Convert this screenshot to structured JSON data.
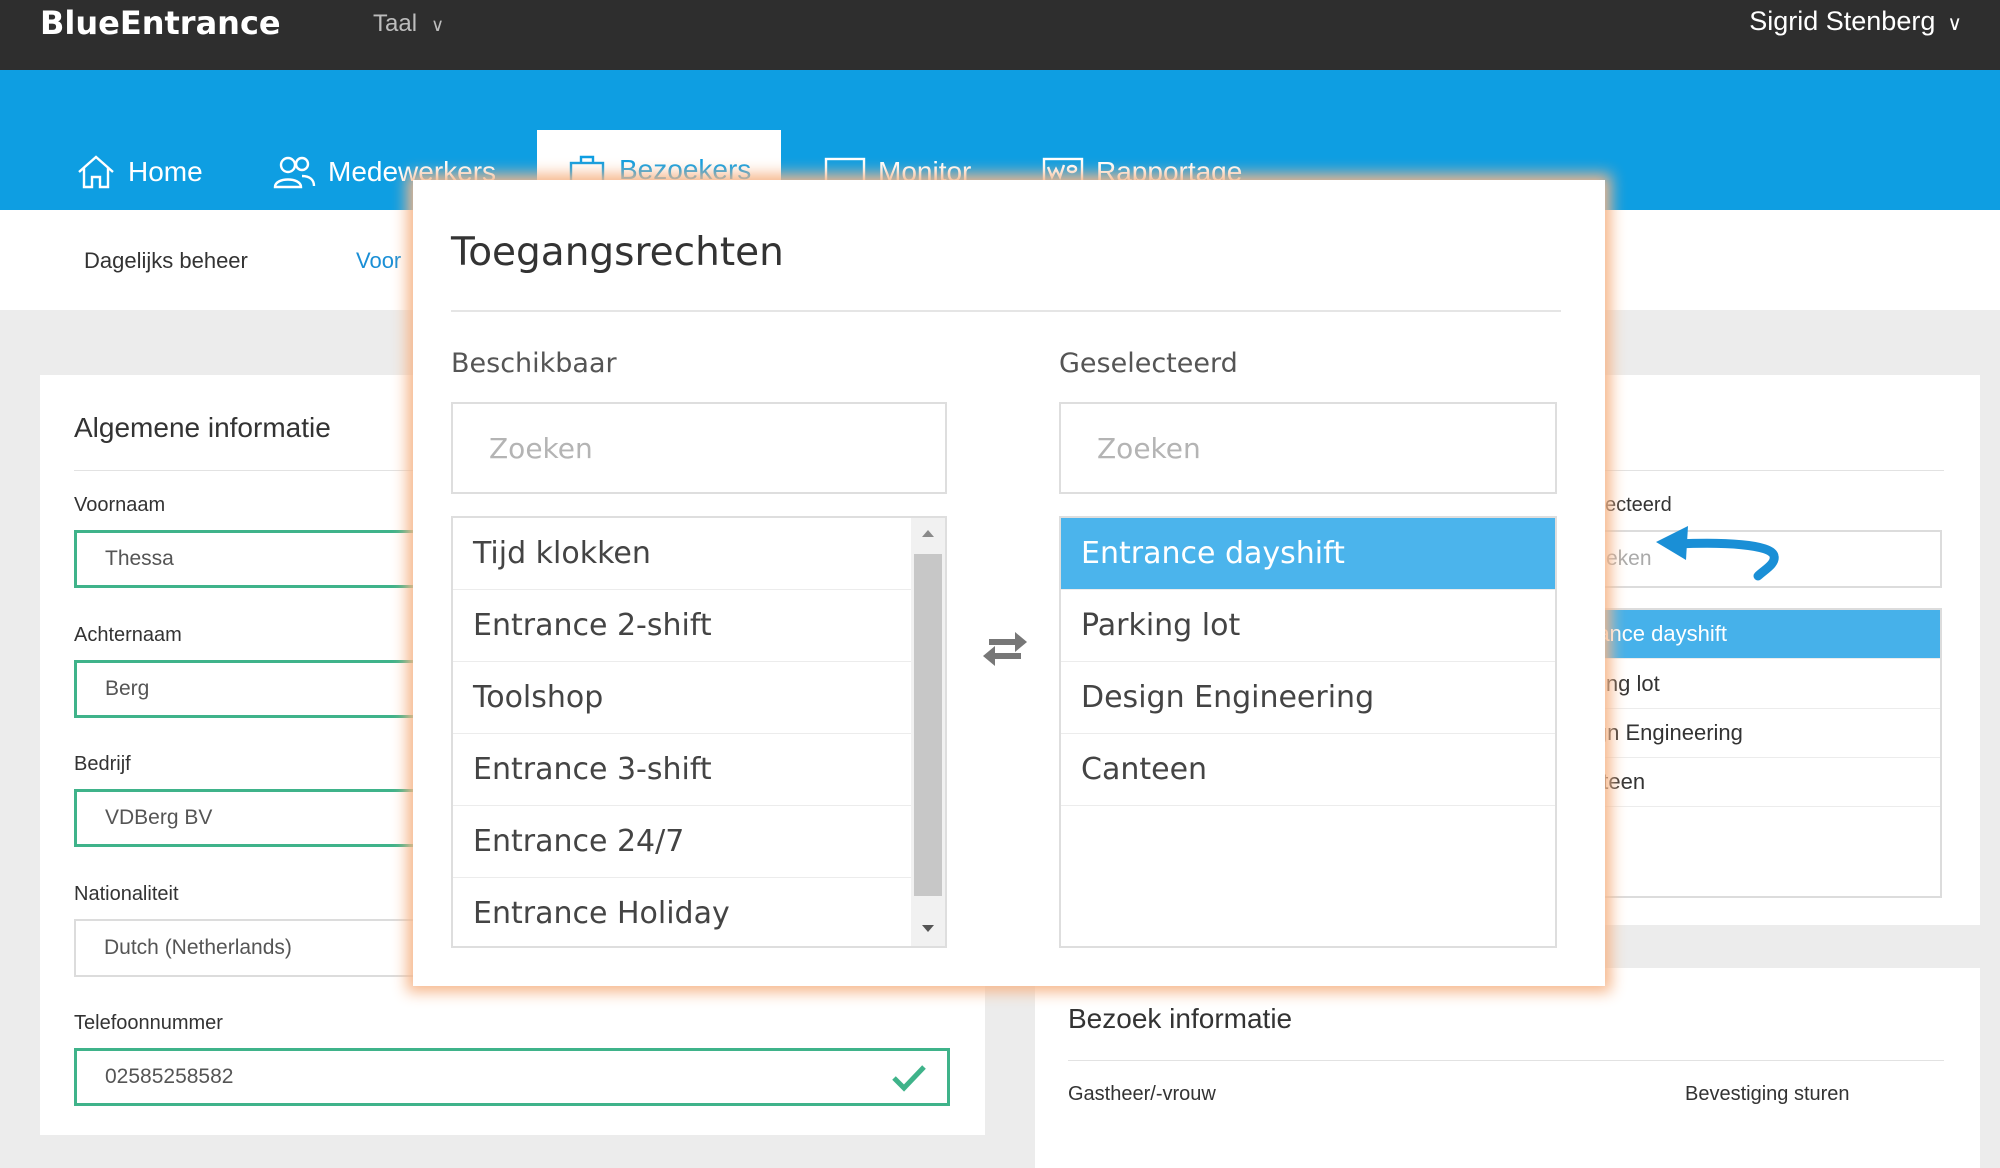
{
  "app": {
    "brand": "BlueEntrance",
    "language_label": "Taal",
    "user_name": "Sigrid Stenberg"
  },
  "nav": {
    "home": "Home",
    "employees": "Medewerkers",
    "visitors": "Bezoekers",
    "monitor": "Monitor",
    "reports": "Rapportage"
  },
  "subnav": {
    "daily": "Dagelijks beheer",
    "second": "Voor"
  },
  "left_card": {
    "title": "Algemene informatie",
    "first_name_label": "Voornaam",
    "first_name": "Thessa",
    "last_name_label": "Achternaam",
    "last_name": "Berg",
    "company_label": "Bedrijf",
    "company": "VDBerg BV",
    "nationality_label": "Nationaliteit",
    "nationality": "Dutch (Netherlands)",
    "phone_label": "Telefoonnummer",
    "phone": "02585258582"
  },
  "right_card_behind": {
    "selected_label": "ecteerd",
    "search_placeholder": "eken",
    "items": [
      "rance dayshift",
      "king lot",
      "ign Engineering",
      "nteen"
    ]
  },
  "visit_card": {
    "title": "Bezoek informatie",
    "host_label": "Gastheer/-vrouw",
    "confirm_label": "Bevestiging sturen"
  },
  "modal": {
    "title": "Toegangsrechten",
    "available_label": "Beschikbaar",
    "selected_label": "Geselecteerd",
    "available_search_placeholder": "Zoeken",
    "selected_search_placeholder": "Zoeken",
    "available_items": [
      "Tijd klokken",
      "Entrance 2-shift",
      "Toolshop",
      "Entrance 3-shift",
      "Entrance 24/7",
      "Entrance Holiday"
    ],
    "selected_items": [
      "Entrance dayshift",
      "Parking lot",
      "Design Engineering",
      "Canteen"
    ],
    "highlighted_selected_item": "Entrance dayshift"
  },
  "colors": {
    "accent": "#0e9ee2",
    "valid_border": "#3fb38a",
    "selection": "#4bb4ec",
    "topbar": "#2e2e2e",
    "modal_glow": "#f6b68a"
  },
  "icons": [
    "home-icon",
    "users-icon",
    "visitor-icon",
    "monitor-icon",
    "report-icon",
    "chevron-down-icon",
    "check-icon",
    "swap-arrows-icon",
    "curved-arrow-icon"
  ]
}
